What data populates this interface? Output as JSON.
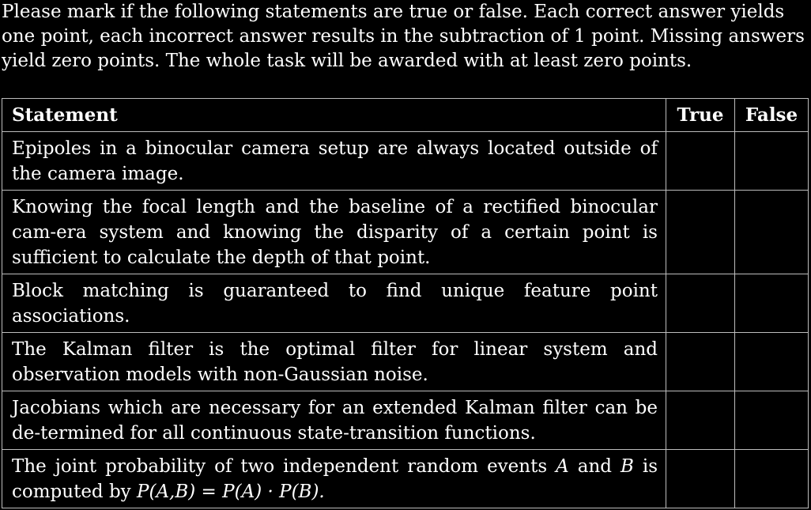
{
  "instructions": "Please mark if the following statements are true or false. Each correct answer yields one point, each incorrect answer results in the subtraction of 1 point. Missing answers yield zero points. The whole task will be awarded with at least zero points.",
  "table": {
    "headers": {
      "statement": "Statement",
      "true": "True",
      "false": "False"
    },
    "rows": [
      {
        "statement": "Epipoles in a binocular camera setup are always located outside of the camera image."
      },
      {
        "statement": "Knowing the focal length and the baseline of a rectified binocular cam-era system and knowing the disparity of a certain point is sufficient to calculate the depth of that point."
      },
      {
        "statement": "Block matching is guaranteed to find unique feature point associations."
      },
      {
        "statement": "The Kalman filter is the optimal filter for linear system and observation models with non-Gaussian noise."
      },
      {
        "statement": "Jacobians which are necessary for an extended Kalman filter can be de-termined for all continuous state-transition functions."
      },
      {
        "statement_prefix": "The joint probability of two independent random events",
        "var_a": "A",
        "and_word": "and",
        "var_b": "B",
        "is_computed_by": "is computed by",
        "formula": "P(A,B) = P(A) · P(B)."
      }
    ]
  }
}
